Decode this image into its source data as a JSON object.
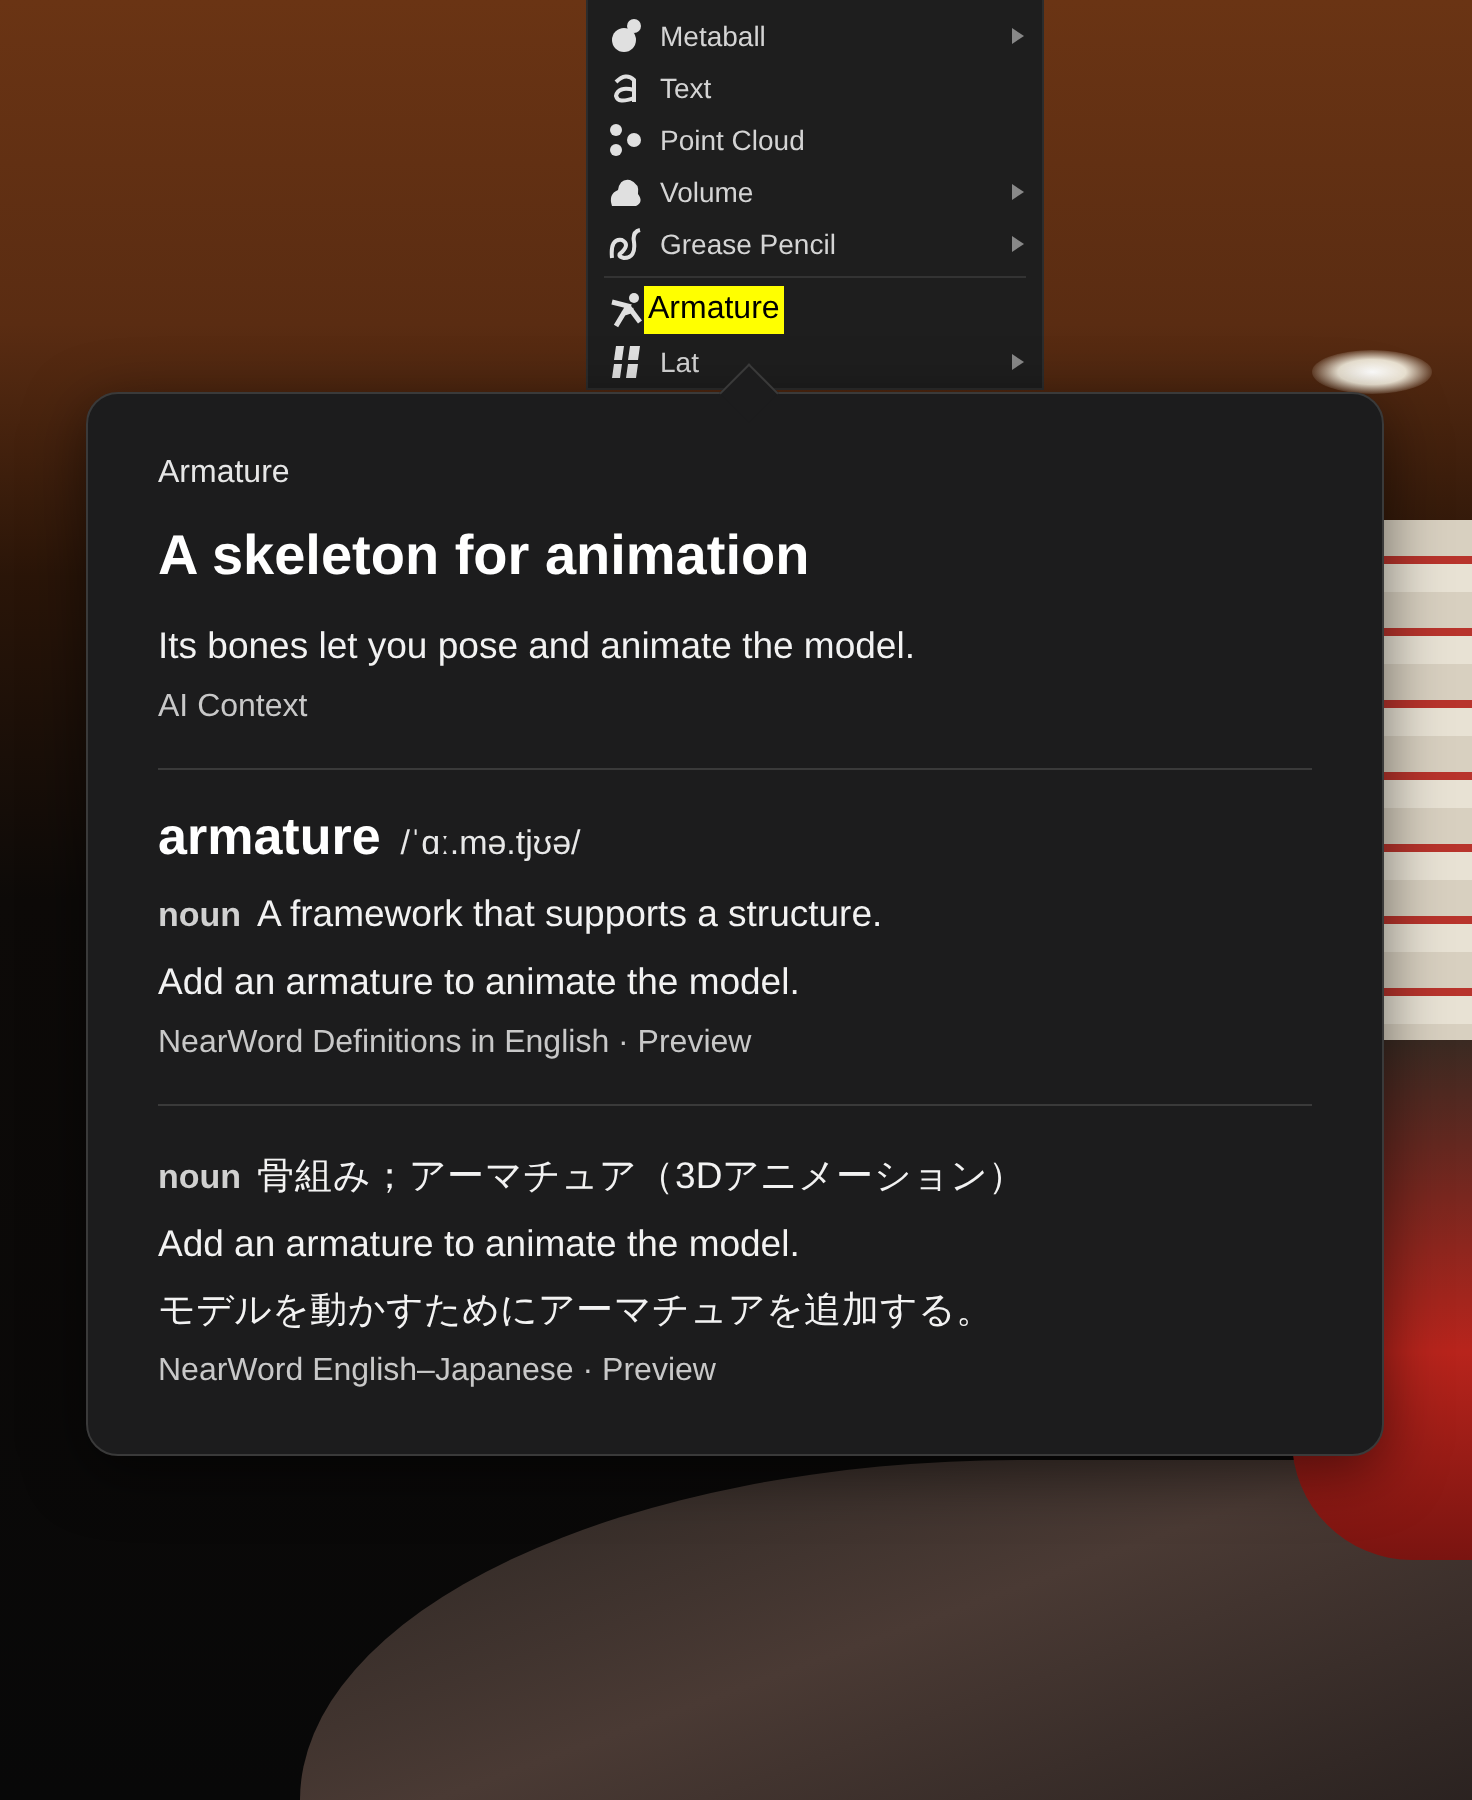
{
  "menu": {
    "items": [
      {
        "kind": "metaball",
        "label": "Metaball",
        "submenu": true,
        "highlighted": false
      },
      {
        "kind": "text",
        "label": "Text",
        "submenu": false,
        "highlighted": false
      },
      {
        "kind": "point_cloud",
        "label": "Point Cloud",
        "submenu": false,
        "highlighted": false
      },
      {
        "kind": "volume",
        "label": "Volume",
        "submenu": true,
        "highlighted": false
      },
      {
        "kind": "grease_pencil",
        "label": "Grease Pencil",
        "submenu": true,
        "highlighted": false
      },
      {
        "kind": "divider"
      },
      {
        "kind": "armature",
        "label": "Armature",
        "submenu": false,
        "highlighted": true
      },
      {
        "kind": "lattice",
        "label": "Lat",
        "submenu": true,
        "highlighted": false
      }
    ]
  },
  "popover": {
    "header": "Armature",
    "title": "A skeleton for animation",
    "summary": "Its bones let you pose and animate the model.",
    "source": "AI Context",
    "entries": [
      {
        "headword": "armature",
        "pronunciation": "/ˈɑː.mə.tjʊə/",
        "pos": "noun",
        "definition": "A framework that supports a structure.",
        "examples": [
          "Add an armature to animate the model."
        ],
        "source": "NearWord Definitions in English · Preview"
      },
      {
        "pos": "noun",
        "definition": "骨組み；アーマチュア（3Dアニメーション）",
        "examples": [
          "Add an armature to animate the model.",
          "モデルを動かすためにアーマチュアを追加する。"
        ],
        "source": "NearWord English–Japanese · Preview"
      }
    ]
  }
}
